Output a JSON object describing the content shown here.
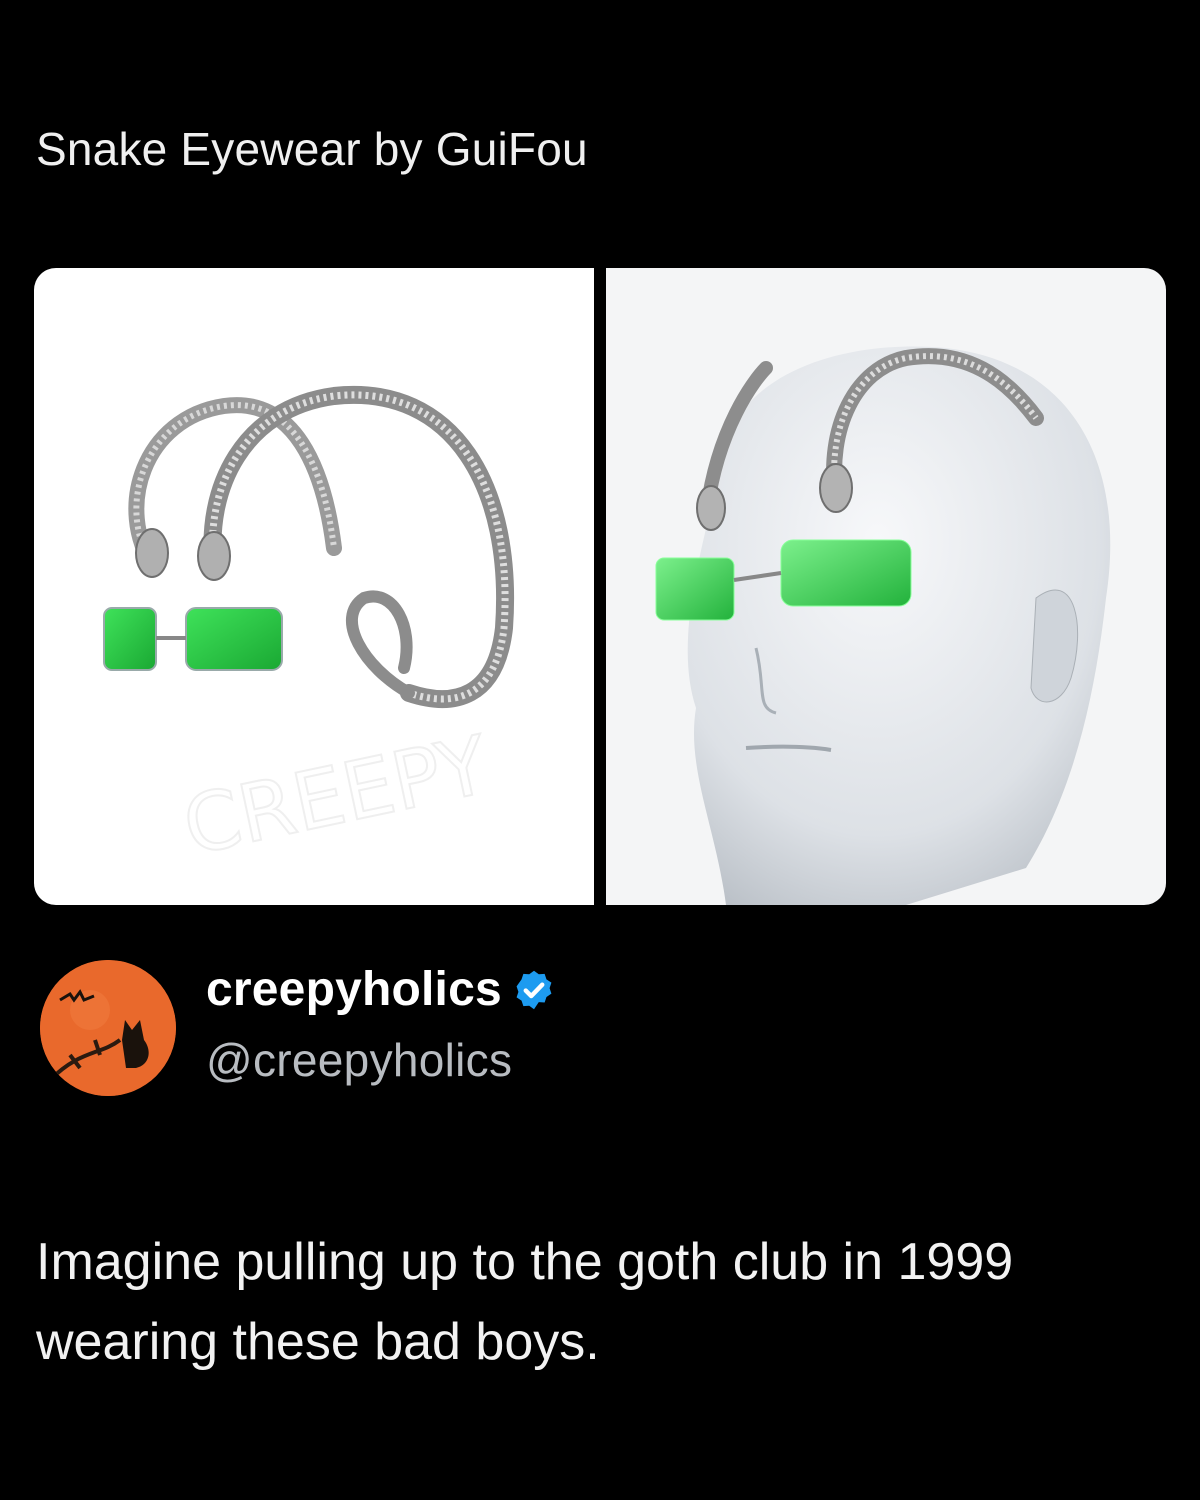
{
  "post": {
    "title": "Snake Eyewear by GuiFou",
    "body": "Imagine pulling up to the goth club in 1999 wearing these bad boys."
  },
  "author": {
    "display_name": "creepyholics",
    "handle": "@creepyholics",
    "verified_icon": "verified-badge-icon",
    "avatar_icon": "orange-moon-cat-avatar"
  },
  "colors": {
    "background": "#000000",
    "verified": "#1d9bf0",
    "lens_green": "#2bd245",
    "avatar_orange": "#e9692c"
  }
}
